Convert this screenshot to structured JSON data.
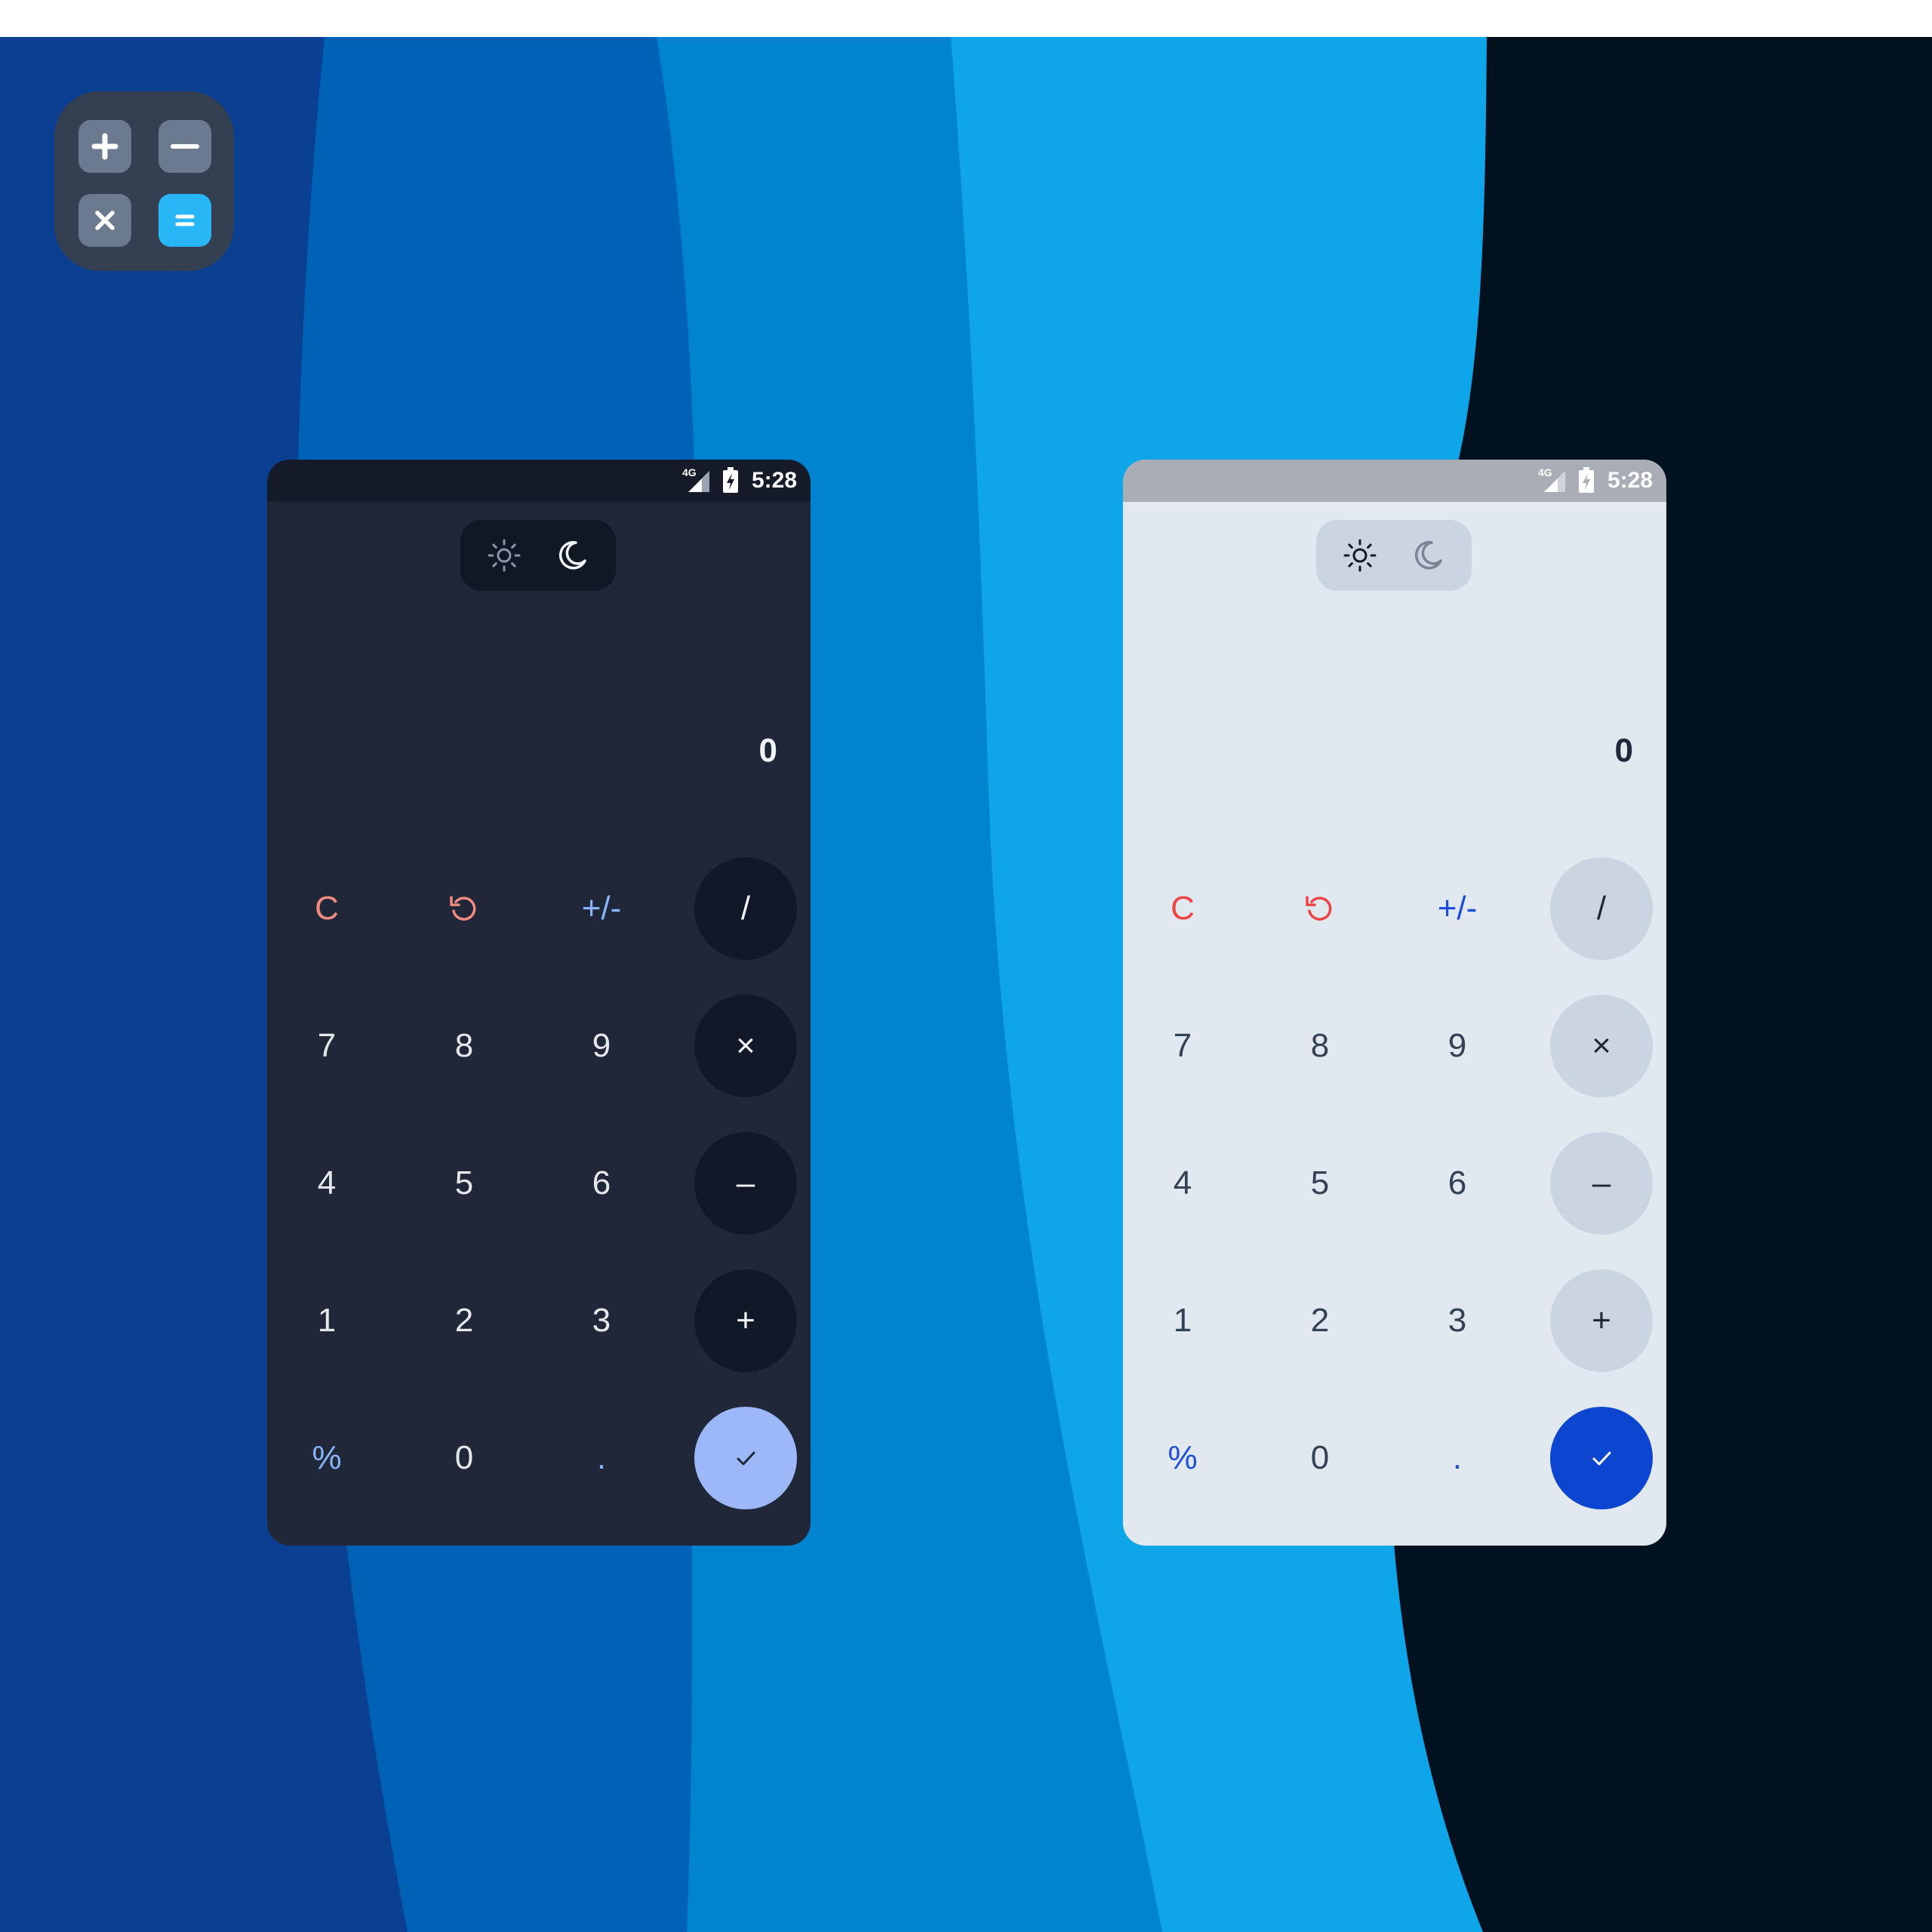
{
  "colors": {
    "bg_stripe_1": "#0a3f92",
    "bg_stripe_2": "#0062b5",
    "bg_stripe_3": "#0084d0",
    "bg_stripe_4": "#0ea5e9",
    "bg_stripe_5": "#001120",
    "dark_surface": "#1f2739",
    "light_surface": "#e2e8f0",
    "equals_dark": "#9cb8f8",
    "equals_light": "#0b45d0",
    "clear_red": "#ef4444",
    "accent_blue": "#1d4ed8"
  },
  "app_icon": {
    "tiles": [
      "plus-icon",
      "minus-icon",
      "multiply-icon",
      "equals-icon"
    ]
  },
  "dark_phone": {
    "status": {
      "network": "4G",
      "time": "5:28"
    },
    "theme_toggle": {
      "light_icon": "sun-icon",
      "dark_icon": "moon-icon"
    },
    "display_value": "0",
    "keys": {
      "clear": "C",
      "undo": "undo-icon",
      "sign": "+/-",
      "divide": "/",
      "seven": "7",
      "eight": "8",
      "nine": "9",
      "multiply": "×",
      "four": "4",
      "five": "5",
      "six": "6",
      "minus": "–",
      "one": "1",
      "two": "2",
      "three": "3",
      "plus": "+",
      "percent": "%",
      "zero": "0",
      "dot": ".",
      "equals": "check-icon"
    }
  },
  "light_phone": {
    "status": {
      "network": "4G",
      "time": "5:28"
    },
    "theme_toggle": {
      "light_icon": "sun-icon",
      "dark_icon": "moon-icon"
    },
    "display_value": "0",
    "keys": {
      "clear": "C",
      "undo": "undo-icon",
      "sign": "+/-",
      "divide": "/",
      "seven": "7",
      "eight": "8",
      "nine": "9",
      "multiply": "×",
      "four": "4",
      "five": "5",
      "six": "6",
      "minus": "–",
      "one": "1",
      "two": "2",
      "three": "3",
      "plus": "+",
      "percent": "%",
      "zero": "0",
      "dot": ".",
      "equals": "check-icon"
    }
  }
}
